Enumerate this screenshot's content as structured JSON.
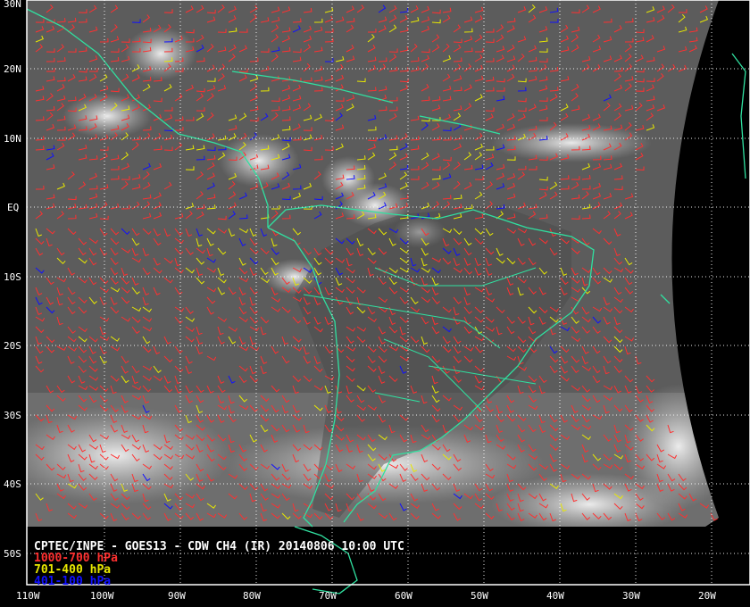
{
  "title": "CPTEC/INPE - GOES13 - CDW CH4 (IR) 20140806 10:00 UTC",
  "legend": [
    {
      "label": "1000-700 hPa",
      "color": "#ff3030"
    },
    {
      "label": "701-400 hPa",
      "color": "#e8e800"
    },
    {
      "label": "401-100 hPa",
      "color": "#1010ff"
    }
  ],
  "lat_labels": [
    "30N",
    "20N",
    "10N",
    "EQ",
    "10S",
    "20S",
    "30S",
    "40S",
    "50S"
  ],
  "lon_labels": [
    "110W",
    "100W",
    "90W",
    "80W",
    "70W",
    "60W",
    "50W",
    "40W",
    "30W",
    "20W"
  ],
  "colors": {
    "coastline": "#30e0a0",
    "grid": "#ffffff",
    "background": "#000000",
    "satellite": "#5a5a5a"
  }
}
